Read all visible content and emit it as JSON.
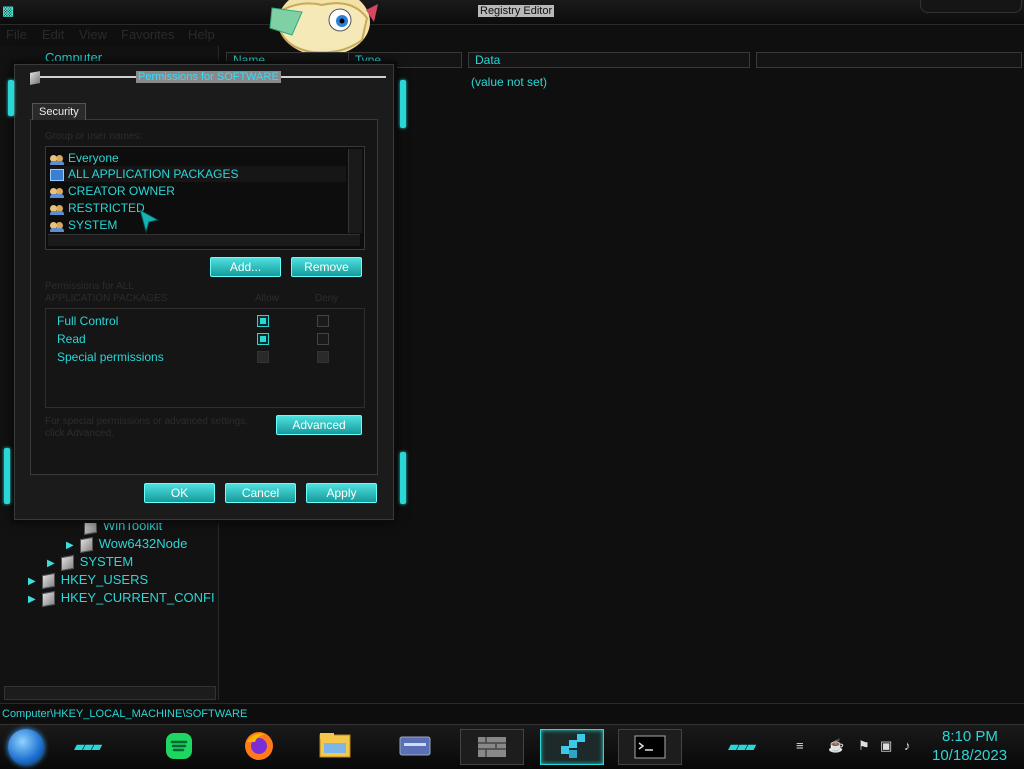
{
  "window": {
    "title": "Registry Editor",
    "menu": [
      "File",
      "Edit",
      "View",
      "Favorites",
      "Help"
    ]
  },
  "tree": {
    "root": "Computer",
    "items": [
      {
        "label": "WinToolkit"
      },
      {
        "label": "Wow6432Node"
      },
      {
        "label": "SYSTEM"
      },
      {
        "label": "HKEY_USERS"
      },
      {
        "label": "HKEY_CURRENT_CONFI"
      }
    ]
  },
  "columns": {
    "name": "Name",
    "type": "Type",
    "data": "Data"
  },
  "values": {
    "default_data": "(value not set)"
  },
  "status": {
    "path": "Computer\\HKEY_LOCAL_MACHINE\\SOFTWARE"
  },
  "dialog": {
    "title": "Permissions for SOFTWARE",
    "tab": "Security",
    "group_label": "Group or user names:",
    "users": [
      "Everyone",
      "ALL APPLICATION PACKAGES",
      "CREATOR OWNER",
      "RESTRICTED",
      "SYSTEM"
    ],
    "add_label": "Add...",
    "remove_label": "Remove",
    "perm_header_line1": "Permissions for ALL",
    "perm_header_line2": "APPLICATION PACKAGES",
    "allow_label": "Allow",
    "deny_label": "Deny",
    "permissions": [
      {
        "name": "Full Control",
        "allow": true,
        "deny": false
      },
      {
        "name": "Read",
        "allow": true,
        "deny": false
      },
      {
        "name": "Special permissions",
        "allow": false,
        "deny": false
      }
    ],
    "advanced_text_line1": "For special permissions or advanced settings,",
    "advanced_text_line2": "click Advanced.",
    "advanced_label": "Advanced",
    "ok_label": "OK",
    "cancel_label": "Cancel",
    "apply_label": "Apply"
  },
  "taskbar": {
    "time": "8:10 PM",
    "date": "10/18/2023",
    "apps": [
      "spotify-icon",
      "firefox-icon",
      "file-explorer-icon",
      "card-icon",
      "wall-icon",
      "registry-editor-icon",
      "command-prompt-icon"
    ],
    "accent": "#2bd6d6"
  }
}
